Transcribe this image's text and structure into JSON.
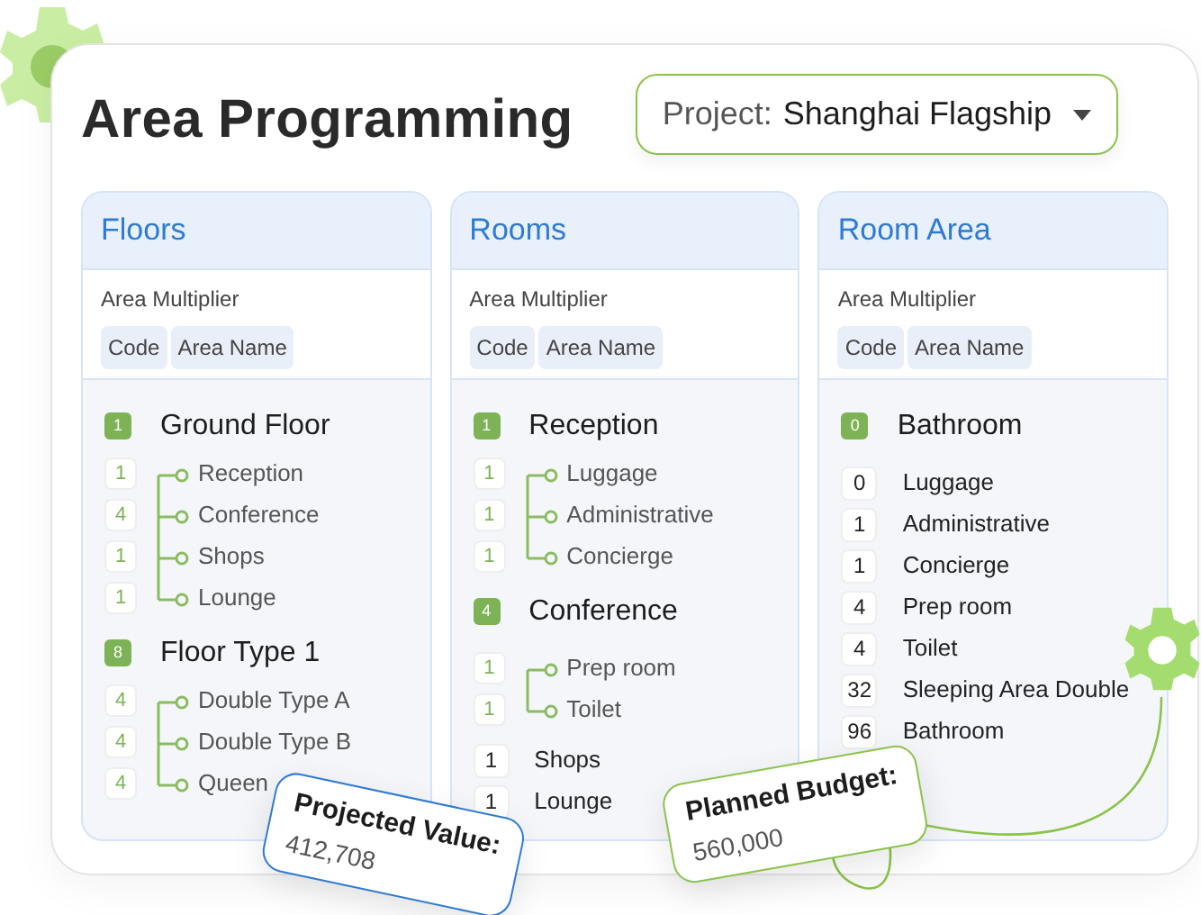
{
  "title": "Area Programming",
  "project": {
    "label": "Project:",
    "value": "Shanghai Flagship"
  },
  "columns": [
    {
      "title": "Floors",
      "multiplier_label": "Area Multiplier",
      "headers": [
        "Code",
        "Area Name"
      ],
      "entries": [
        {
          "kind": "group",
          "code": "1",
          "name": "Ground Floor",
          "children": [
            {
              "code": "1",
              "name": "Reception"
            },
            {
              "code": "4",
              "name": "Conference"
            },
            {
              "code": "1",
              "name": "Shops"
            },
            {
              "code": "1",
              "name": "Lounge"
            }
          ]
        },
        {
          "kind": "group",
          "code": "8",
          "name": "Floor Type 1",
          "children": [
            {
              "code": "4",
              "name": "Double Type A"
            },
            {
              "code": "4",
              "name": "Double Type B"
            },
            {
              "code": "4",
              "name": "Queen"
            }
          ]
        }
      ]
    },
    {
      "title": "Rooms",
      "multiplier_label": "Area Multiplier",
      "headers": [
        "Code",
        "Area Name"
      ],
      "entries": [
        {
          "kind": "group",
          "code": "1",
          "name": "Reception",
          "children": [
            {
              "code": "1",
              "name": "Luggage"
            },
            {
              "code": "1",
              "name": "Administrative"
            },
            {
              "code": "1",
              "name": "Concierge"
            }
          ]
        },
        {
          "kind": "group",
          "code": "4",
          "name": "Conference",
          "children": [
            {
              "code": "1",
              "name": "Prep room"
            },
            {
              "code": "1",
              "name": "Toilet"
            }
          ]
        },
        {
          "kind": "item",
          "code": "1",
          "name": "Shops"
        },
        {
          "kind": "item",
          "code": "1",
          "name": "Lounge"
        }
      ]
    },
    {
      "title": "Room Area",
      "multiplier_label": "Area Multiplier",
      "headers": [
        "Code",
        "Area Name"
      ],
      "entries": [
        {
          "kind": "group",
          "code": "0",
          "name": "Bathroom"
        },
        {
          "kind": "item",
          "code": "0",
          "name": "Luggage"
        },
        {
          "kind": "item",
          "code": "1",
          "name": "Administrative"
        },
        {
          "kind": "item",
          "code": "1",
          "name": "Concierge"
        },
        {
          "kind": "item",
          "code": "4",
          "name": "Prep room"
        },
        {
          "kind": "item",
          "code": "4",
          "name": "Toilet"
        },
        {
          "kind": "item",
          "code": "32",
          "name": "Sleeping Area Double"
        },
        {
          "kind": "item",
          "code": "96",
          "name": "Bathroom"
        }
      ]
    }
  ],
  "tags": [
    {
      "kind": "projected",
      "label": "Projected Value:",
      "value": "412,708"
    },
    {
      "kind": "budget",
      "label": "Planned Budget:",
      "value": "560,000"
    }
  ]
}
